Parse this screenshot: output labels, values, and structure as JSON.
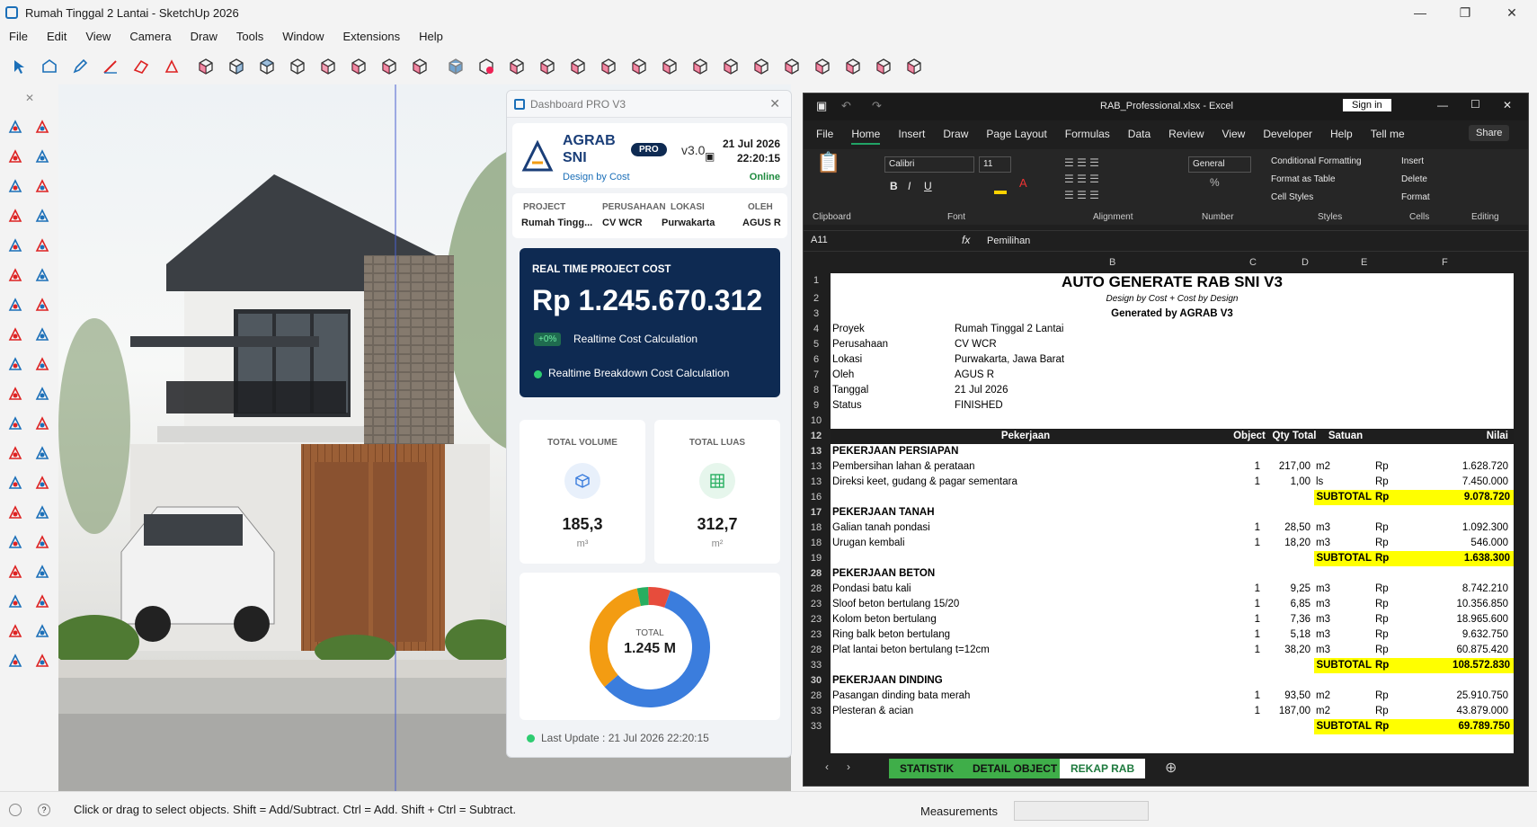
{
  "window": {
    "title": "Rumah Tinggal 2 Lantai - SketchUp 2026"
  },
  "menu": [
    "File",
    "Edit",
    "View",
    "Camera",
    "Draw",
    "Tools",
    "Window",
    "Extensions",
    "Help"
  ],
  "status": {
    "hint": "Click or drag to select objects. Shift = Add/Subtract. Ctrl = Add. Shift + Ctrl = Subtract.",
    "measurements_label": "Measurements"
  },
  "dashboard": {
    "title": "Dashboard PRO V3",
    "brand": "AGRAB SNI",
    "badge": "PRO",
    "version": "v3.0",
    "tagline": "Design by Cost",
    "date": "21 Jul 2026",
    "time": "22:20:15",
    "online": "Online",
    "info": [
      {
        "k": "PROJECT",
        "v": "Rumah Tingg..."
      },
      {
        "k": "PERUSAHAAN",
        "v": "CV WCR"
      },
      {
        "k": "LOKASI",
        "v": "Purwakarta"
      },
      {
        "k": "OLEH",
        "v": "AGUS R"
      }
    ],
    "cost_title": "REAL TIME PROJECT COST",
    "cost": "Rp 1.245.670.312",
    "delta": "+0%",
    "calc": "Realtime Cost Calculation",
    "breakdown": "Realtime Breakdown Cost Calculation",
    "volume": {
      "label": "TOTAL VOLUME",
      "value": "185,3",
      "unit": "m³"
    },
    "luas": {
      "label": "TOTAL LUAS",
      "value": "312,7",
      "unit": "m²"
    },
    "donut": {
      "label": "TOTAL",
      "value": "1.245 M",
      "slices": [
        {
          "name": "blue",
          "pct": 0.58,
          "color": "#3b7ddd"
        },
        {
          "name": "orange",
          "pct": 0.33,
          "color": "#f39c12"
        },
        {
          "name": "green",
          "pct": 0.03,
          "color": "#27ae60"
        },
        {
          "name": "red",
          "pct": 0.06,
          "color": "#e74c3c"
        }
      ]
    },
    "last_update": "Last Update : 21 Jul 2026 22:20:15"
  },
  "excel": {
    "filename": "RAB_Professional.xlsx - Excel",
    "signin": "Sign in",
    "tabs": [
      "File",
      "Home",
      "Insert",
      "Draw",
      "Page Layout",
      "Formulas",
      "Data",
      "Review",
      "View",
      "Developer",
      "Help",
      "Tell me"
    ],
    "share": "Share",
    "ribbon": {
      "font": "Calibri",
      "size": "11",
      "format": "General",
      "cf": "Conditional Formatting",
      "table": "Format as Table",
      "styles": "Cell Styles",
      "insert": "Insert",
      "delete": "Delete",
      "fmt": "Format",
      "groups": [
        "Clipboard",
        "Font",
        "Alignment",
        "Number",
        "Styles",
        "Cells",
        "Editing"
      ]
    },
    "namebox": "A11",
    "formula": "Pemilihan",
    "cols": [
      "B",
      "C",
      "D",
      "E",
      "F"
    ],
    "title": "AUTO GENERATE RAB SNI V3",
    "subtitle": "Design by Cost + Cost by Design",
    "generated": "Generated by AGRAB V3",
    "meta": [
      {
        "r": "4",
        "k": "Proyek",
        "v": "Rumah Tinggal 2 Lantai"
      },
      {
        "r": "5",
        "k": "Perusahaan",
        "v": "CV WCR"
      },
      {
        "r": "6",
        "k": "Lokasi",
        "v": "Purwakarta, Jawa Barat"
      },
      {
        "r": "7",
        "k": "Oleh",
        "v": "AGUS R"
      },
      {
        "r": "8",
        "k": "Tanggal",
        "v": "21 Jul 2026"
      },
      {
        "r": "9",
        "k": "Status",
        "v": "FINISHED"
      }
    ],
    "header": {
      "r": "12",
      "pek": "Pekerjaan",
      "obj": "Object",
      "qty": "Qty Total",
      "sat": "Satuan",
      "nil": "Nilai"
    },
    "sections": [
      {
        "r": "13",
        "name": "PEKERJAAN PERSIAPAN",
        "items": [
          {
            "r": "13",
            "n": "Pembersihan lahan & perataan",
            "o": "1",
            "q": "217,00",
            "s": "m2",
            "v": "1.628.720"
          },
          {
            "r": "13",
            "n": "Direksi keet, gudang & pagar sementara",
            "o": "1",
            "q": "1,00",
            "s": "ls",
            "v": "7.450.000"
          }
        ],
        "sr": "16",
        "sub": "9.078.720"
      },
      {
        "r": "17",
        "name": "PEKERJAAN TANAH",
        "items": [
          {
            "r": "18",
            "n": "Galian tanah pondasi",
            "o": "1",
            "q": "28,50",
            "s": "m3",
            "v": "1.092.300"
          },
          {
            "r": "18",
            "n": "Urugan kembali",
            "o": "1",
            "q": "18,20",
            "s": "m3",
            "v": "546.000"
          }
        ],
        "sr": "19",
        "sub": "1.638.300"
      },
      {
        "r": "28",
        "name": "PEKERJAAN BETON",
        "items": [
          {
            "r": "28",
            "n": "Pondasi batu kali",
            "o": "1",
            "q": "9,25",
            "s": "m3",
            "v": "8.742.210"
          },
          {
            "r": "23",
            "n": "Sloof beton bertulang 15/20",
            "o": "1",
            "q": "6,85",
            "s": "m3",
            "v": "10.356.850"
          },
          {
            "r": "23",
            "n": "Kolom beton bertulang",
            "o": "1",
            "q": "7,36",
            "s": "m3",
            "v": "18.965.600"
          },
          {
            "r": "23",
            "n": "Ring balk beton bertulang",
            "o": "1",
            "q": "5,18",
            "s": "m3",
            "v": "9.632.750"
          },
          {
            "r": "28",
            "n": "Plat lantai beton bertulang t=12cm",
            "o": "1",
            "q": "38,20",
            "s": "m3",
            "v": "60.875.420"
          }
        ],
        "sr": "33",
        "sub": "108.572.830"
      },
      {
        "r": "30",
        "name": "PEKERJAAN DINDING",
        "items": [
          {
            "r": "28",
            "n": "Pasangan dinding bata merah",
            "o": "1",
            "q": "93,50",
            "s": "m2",
            "v": "25.910.750"
          },
          {
            "r": "33",
            "n": "Plesteran & acian",
            "o": "1",
            "q": "187,00",
            "s": "m2",
            "v": "43.879.000"
          }
        ],
        "sr": "33",
        "sub": "69.789.750"
      }
    ],
    "subtotal": "SUBTOTAL",
    "rp": "Rp",
    "sheets": [
      "STATISTIK",
      "DETAIL OBJECT",
      "REKAP RAB"
    ]
  }
}
